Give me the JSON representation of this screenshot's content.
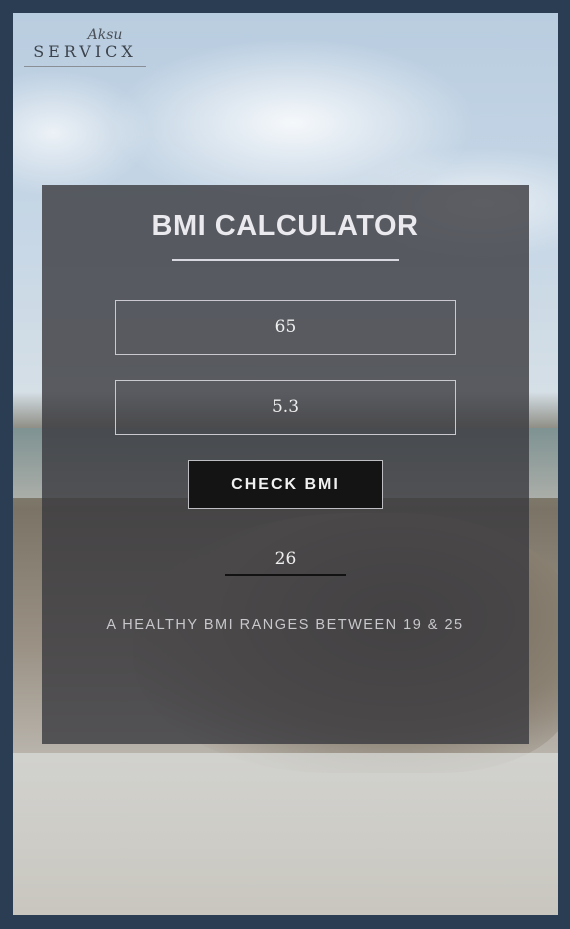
{
  "logo": {
    "script": "Aksu",
    "wordmark": "SERVICX"
  },
  "calculator": {
    "title": "BMI CALCULATOR",
    "weight_value": "65",
    "height_value": "5.3",
    "button_label": "CHECK BMI",
    "result": "26",
    "note": "A HEALTHY BMI RANGES BETWEEN 19 & 25"
  }
}
